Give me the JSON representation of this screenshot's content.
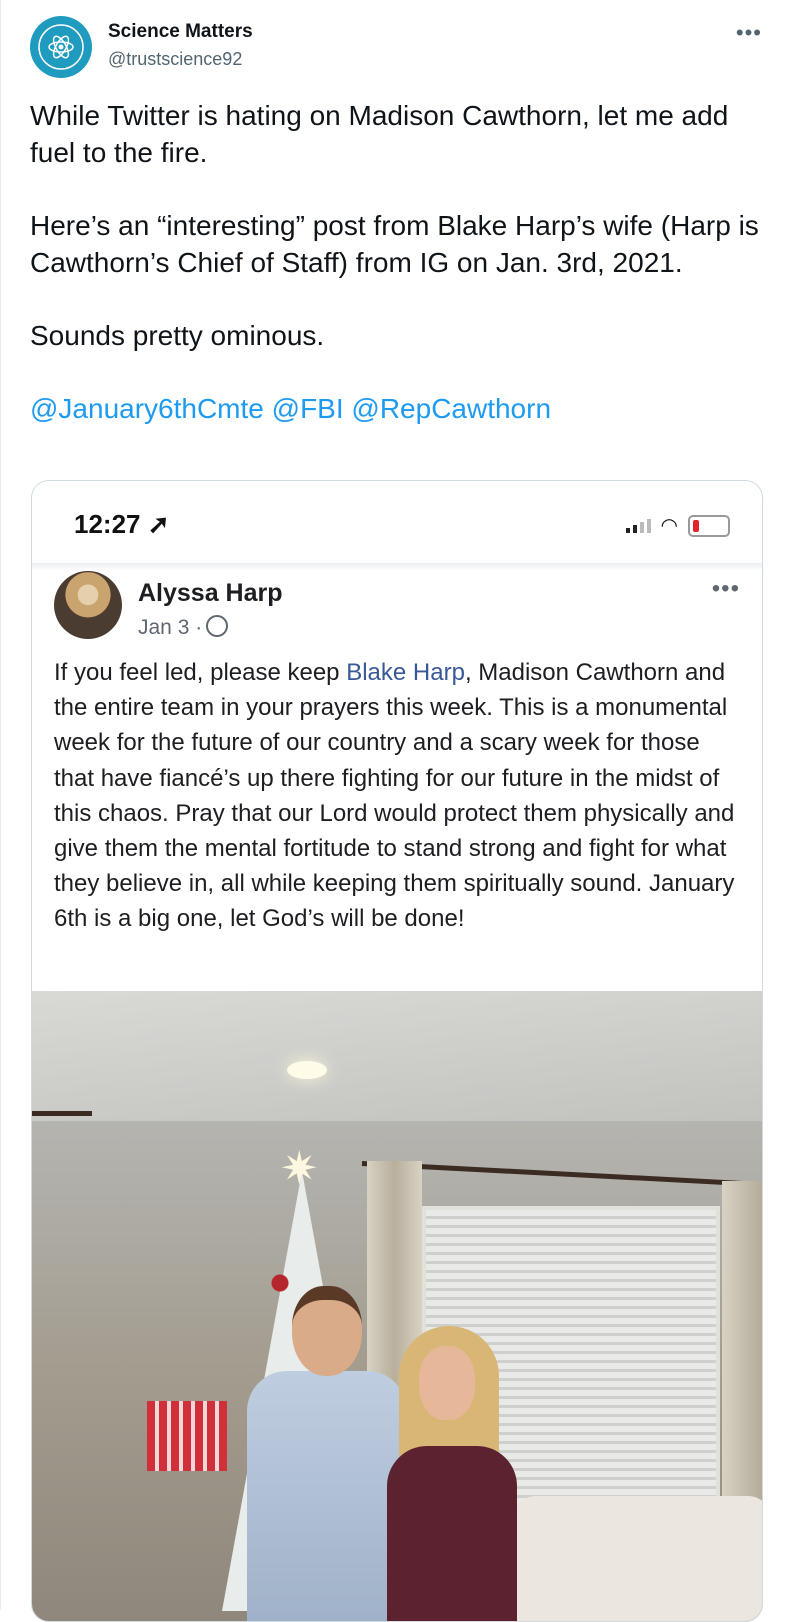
{
  "tweet": {
    "author_name": "Science Matters",
    "author_handle": "@trustscience92",
    "paragraphs": [
      "While Twitter is hating on Madison Cawthorn, let me add fuel to the fire.",
      "Here’s an “interesting” post from Blake Harp’s wife (Harp is Cawthorn’s Chief of Staff) from IG on Jan. 3rd, 2021.",
      "Sounds pretty ominous."
    ],
    "mentions": [
      "@January6thCmte",
      "@FBI",
      "@RepCawthorn"
    ]
  },
  "screenshot": {
    "status_time": "12:27",
    "post_author": "Alyssa Harp",
    "post_date": "Jan 3 ·",
    "post_text_before": "If you feel led, please keep ",
    "post_link": "Blake Harp",
    "post_text_after": ", Madison Cawthorn and the entire team in your prayers this week. This is a monumental week for the future of our country and a scary week for those that have fiancé’s up there fighting for our future in the midst of this chaos. Pray that our Lord would protect them physically and give them the mental fortitude to stand strong and fight for what they believe in, all while keeping them spiritually sound. January 6th is a big one, let God’s will be done!"
  },
  "colors": {
    "link_blue": "#1d9bf0",
    "fb_link": "#385898",
    "avatar_teal": "#1f9bbf"
  }
}
